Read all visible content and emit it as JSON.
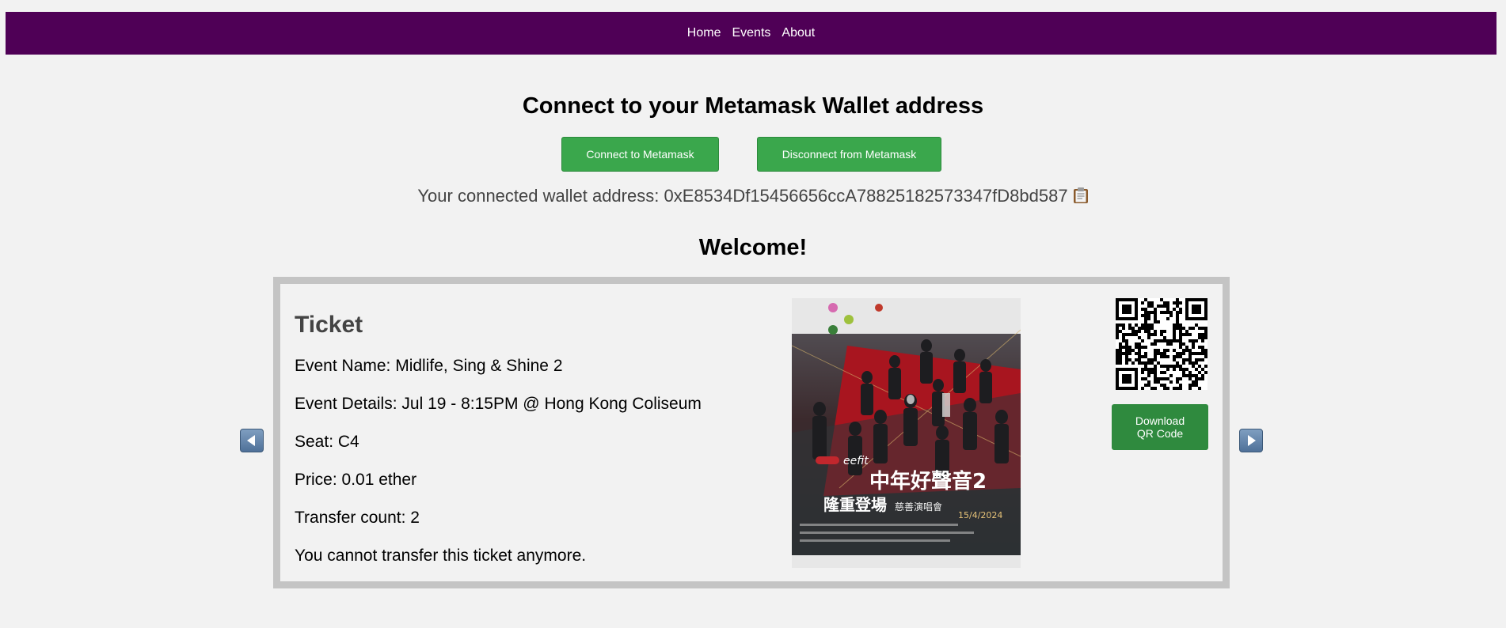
{
  "nav": {
    "items": [
      {
        "label": "Home"
      },
      {
        "label": "Events"
      },
      {
        "label": "About"
      }
    ]
  },
  "connect": {
    "title": "Connect to your Metamask Wallet address",
    "connect_label": "Connect to Metamask",
    "disconnect_label": "Disconnect from Metamask",
    "wallet_prefix": "Your connected wallet address: ",
    "wallet_address": "0xE8534Df15456656ccA78825182573347fD8bd587",
    "copy_icon": "clipboard-icon"
  },
  "welcome": "Welcome!",
  "ticket": {
    "heading": "Ticket",
    "event_name": "Event Name: Midlife, Sing & Shine 2",
    "event_details": "Event Details: Jul 19 - 8:15PM @ Hong Kong Coliseum",
    "seat": "Seat: C4",
    "price": "Price: 0.01 ether",
    "transfer_count": "Transfer count: 2",
    "transfer_note": "You cannot transfer this ticket anymore.",
    "download_label_line1": "Download",
    "download_label_line2": "QR Code",
    "poster_title": "中年好聲音2",
    "poster_subtitle": "隆重登場",
    "poster_caption": "慈善演唱會",
    "poster_date": "15/4/2024"
  },
  "colors": {
    "nav_bg": "#4f0056",
    "button_green": "#3aa74c",
    "card_border": "#c4c4c4"
  }
}
